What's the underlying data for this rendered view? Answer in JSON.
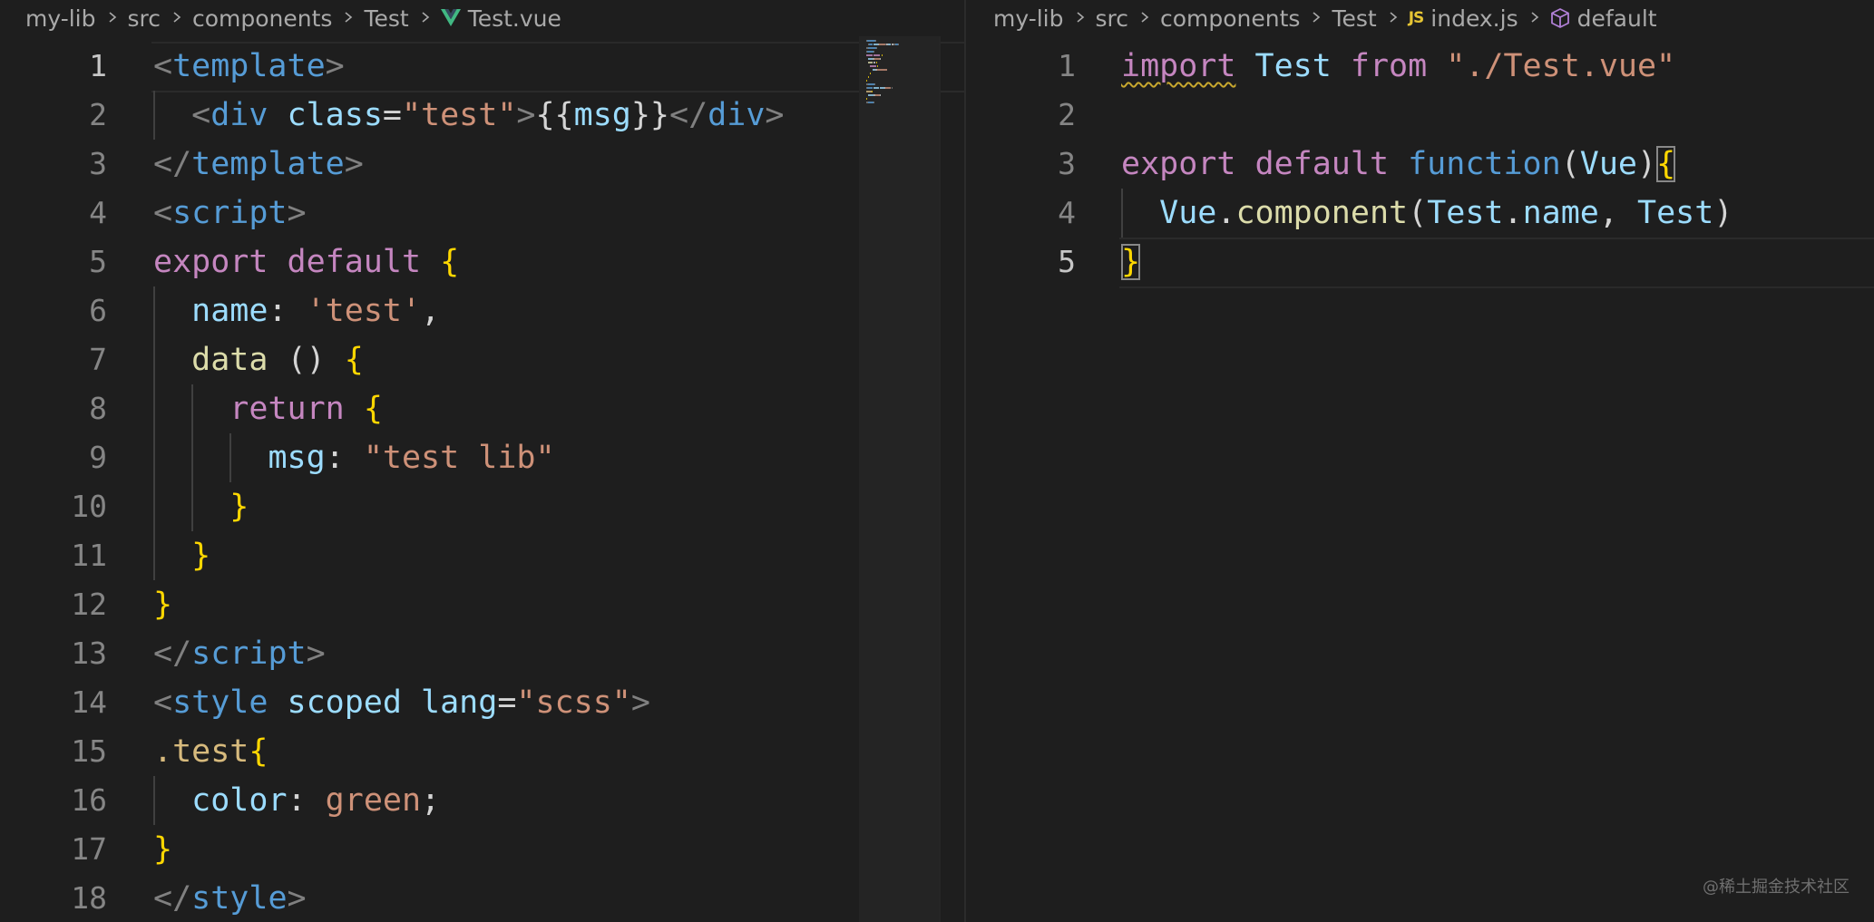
{
  "left_editor": {
    "breadcrumb": {
      "crumbs": [
        "my-lib",
        "src",
        "components",
        "Test"
      ],
      "file": "Test.vue",
      "file_icon": "vue-icon"
    },
    "lines": [
      {
        "n": "1",
        "active": true,
        "tokens": [
          [
            "<",
            "punct"
          ],
          [
            "template",
            "tag"
          ],
          [
            ">",
            "punct"
          ]
        ]
      },
      {
        "n": "2",
        "tokens": [
          [
            "  ",
            "plain"
          ],
          [
            "<",
            "punct"
          ],
          [
            "div",
            "tag"
          ],
          [
            " ",
            "plain"
          ],
          [
            "class",
            "attr"
          ],
          [
            "=",
            "plain"
          ],
          [
            "\"test\"",
            "str"
          ],
          [
            ">",
            "punct"
          ],
          [
            "{{",
            "plain"
          ],
          [
            "msg",
            "var"
          ],
          [
            "}}",
            "plain"
          ],
          [
            "</",
            "punct"
          ],
          [
            "div",
            "tag"
          ],
          [
            ">",
            "punct"
          ]
        ]
      },
      {
        "n": "3",
        "tokens": [
          [
            "</",
            "punct"
          ],
          [
            "template",
            "tag"
          ],
          [
            ">",
            "punct"
          ]
        ]
      },
      {
        "n": "4",
        "tokens": [
          [
            "<",
            "punct"
          ],
          [
            "script",
            "tag"
          ],
          [
            ">",
            "punct"
          ]
        ]
      },
      {
        "n": "5",
        "tokens": [
          [
            "export",
            "kw"
          ],
          [
            " ",
            "plain"
          ],
          [
            "default",
            "kw"
          ],
          [
            " ",
            "plain"
          ],
          [
            "{",
            "brace-yellow"
          ]
        ]
      },
      {
        "n": "6",
        "tokens": [
          [
            "  ",
            "plain"
          ],
          [
            "name",
            "var"
          ],
          [
            ": ",
            "plain"
          ],
          [
            "'test'",
            "str"
          ],
          [
            ",",
            "plain"
          ]
        ]
      },
      {
        "n": "7",
        "tokens": [
          [
            "  ",
            "plain"
          ],
          [
            "data",
            "fn"
          ],
          [
            " ",
            "plain"
          ],
          [
            "()",
            "plain"
          ],
          [
            " ",
            "plain"
          ],
          [
            "{",
            "brace-yellow"
          ]
        ]
      },
      {
        "n": "8",
        "tokens": [
          [
            "    ",
            "plain"
          ],
          [
            "return",
            "kw"
          ],
          [
            " ",
            "plain"
          ],
          [
            "{",
            "brace-yellow"
          ]
        ]
      },
      {
        "n": "9",
        "tokens": [
          [
            "      ",
            "plain"
          ],
          [
            "msg",
            "var"
          ],
          [
            ": ",
            "plain"
          ],
          [
            "\"test lib\"",
            "str"
          ]
        ]
      },
      {
        "n": "10",
        "tokens": [
          [
            "    ",
            "plain"
          ],
          [
            "}",
            "brace-yellow"
          ]
        ]
      },
      {
        "n": "11",
        "tokens": [
          [
            "  ",
            "plain"
          ],
          [
            "}",
            "brace-yellow"
          ]
        ]
      },
      {
        "n": "12",
        "tokens": [
          [
            "}",
            "brace-yellow"
          ]
        ]
      },
      {
        "n": "13",
        "tokens": [
          [
            "</",
            "punct"
          ],
          [
            "script",
            "tag"
          ],
          [
            ">",
            "punct"
          ]
        ]
      },
      {
        "n": "14",
        "tokens": [
          [
            "<",
            "punct"
          ],
          [
            "style",
            "tag"
          ],
          [
            " ",
            "plain"
          ],
          [
            "scoped",
            "attr"
          ],
          [
            " ",
            "plain"
          ],
          [
            "lang",
            "attr"
          ],
          [
            "=",
            "plain"
          ],
          [
            "\"scss\"",
            "str"
          ],
          [
            ">",
            "punct"
          ]
        ]
      },
      {
        "n": "15",
        "tokens": [
          [
            ".test",
            "class"
          ],
          [
            "{",
            "brace-yellow"
          ]
        ]
      },
      {
        "n": "16",
        "tokens": [
          [
            "  ",
            "plain"
          ],
          [
            "color",
            "var"
          ],
          [
            ": ",
            "plain"
          ],
          [
            "green",
            "str"
          ],
          [
            ";",
            "plain"
          ]
        ]
      },
      {
        "n": "17",
        "tokens": [
          [
            "}",
            "brace-yellow"
          ]
        ]
      },
      {
        "n": "18",
        "tokens": [
          [
            "</",
            "punct"
          ],
          [
            "style",
            "tag"
          ],
          [
            ">",
            "punct"
          ]
        ]
      }
    ]
  },
  "right_editor": {
    "breadcrumb": {
      "crumbs": [
        "my-lib",
        "src",
        "components",
        "Test"
      ],
      "file": "index.js",
      "file_icon_text": "JS",
      "symbol": "default",
      "symbol_icon": "cube-icon"
    },
    "lines": [
      {
        "n": "1",
        "tokens": [
          [
            "import",
            "kw squiggle"
          ],
          [
            " ",
            "plain"
          ],
          [
            "Test",
            "var"
          ],
          [
            " ",
            "plain"
          ],
          [
            "from",
            "kw"
          ],
          [
            " ",
            "plain"
          ],
          [
            "\"./Test.vue\"",
            "str"
          ]
        ]
      },
      {
        "n": "2",
        "tokens": []
      },
      {
        "n": "3",
        "tokens": [
          [
            "export",
            "kw"
          ],
          [
            " ",
            "plain"
          ],
          [
            "default",
            "kw"
          ],
          [
            " ",
            "plain"
          ],
          [
            "function",
            "storage"
          ],
          [
            "(",
            "plain"
          ],
          [
            "Vue",
            "var"
          ],
          [
            ")",
            "plain"
          ],
          [
            "{",
            "brace-yellow bracket-match"
          ]
        ]
      },
      {
        "n": "4",
        "tokens": [
          [
            "  ",
            "plain"
          ],
          [
            "Vue",
            "var"
          ],
          [
            ".",
            "plain"
          ],
          [
            "component",
            "fn"
          ],
          [
            "(",
            "plain"
          ],
          [
            "Test",
            "var"
          ],
          [
            ".",
            "plain"
          ],
          [
            "name",
            "var"
          ],
          [
            ", ",
            "plain"
          ],
          [
            "Test",
            "var"
          ],
          [
            ")",
            "plain"
          ]
        ]
      },
      {
        "n": "5",
        "active": true,
        "tokens": [
          [
            "}",
            "brace-yellow bracket-match"
          ]
        ]
      }
    ]
  },
  "watermark": "@稀土掘金技术社区",
  "colors": {
    "background": "#1e1e1e",
    "keyword": "#c586c0",
    "tag": "#569cd6",
    "string": "#ce9178",
    "variable": "#9cdcfe",
    "function": "#dcdcaa",
    "brace": "#ffd700",
    "vue_logo": "#41b883",
    "js_icon": "#e6c534",
    "symbol_icon": "#b180d7"
  }
}
